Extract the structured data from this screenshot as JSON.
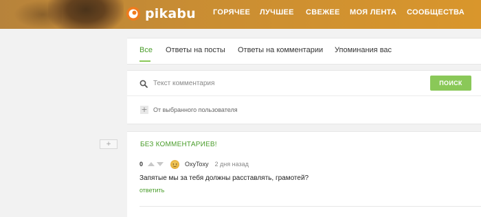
{
  "header": {
    "logo_text": "pikabu",
    "nav": [
      {
        "label": "ГОРЯЧЕЕ"
      },
      {
        "label": "ЛУЧШЕЕ"
      },
      {
        "label": "СВЕЖЕЕ"
      },
      {
        "label": "МОЯ ЛЕНТА"
      },
      {
        "label": "СООБЩЕСТВА"
      }
    ]
  },
  "tabs": [
    {
      "label": "Все",
      "active": true
    },
    {
      "label": "Ответы на посты",
      "active": false
    },
    {
      "label": "Ответы на комментарии",
      "active": false
    },
    {
      "label": "Упоминания вас",
      "active": false
    }
  ],
  "search": {
    "placeholder": "Текст комментария",
    "button_label": "ПОИСК",
    "user_filter_label": "От выбранного пользователя",
    "user_filter_icon": "plus-icon"
  },
  "story": {
    "expand_label": "+",
    "title": "БЕЗ КОММЕНТАРИЕВ!",
    "comment": {
      "rating": "0",
      "author": "OxyToxy",
      "time": "2 дня назад",
      "text": "Запятые мы за тебя должны расставлять, грамотей?",
      "reply_label": "ответить"
    }
  },
  "colors": {
    "brand_green": "#8ac858",
    "link_green": "#4a9d2b",
    "header_orange": "#d9962c",
    "logo_orange": "#f07b1d"
  }
}
